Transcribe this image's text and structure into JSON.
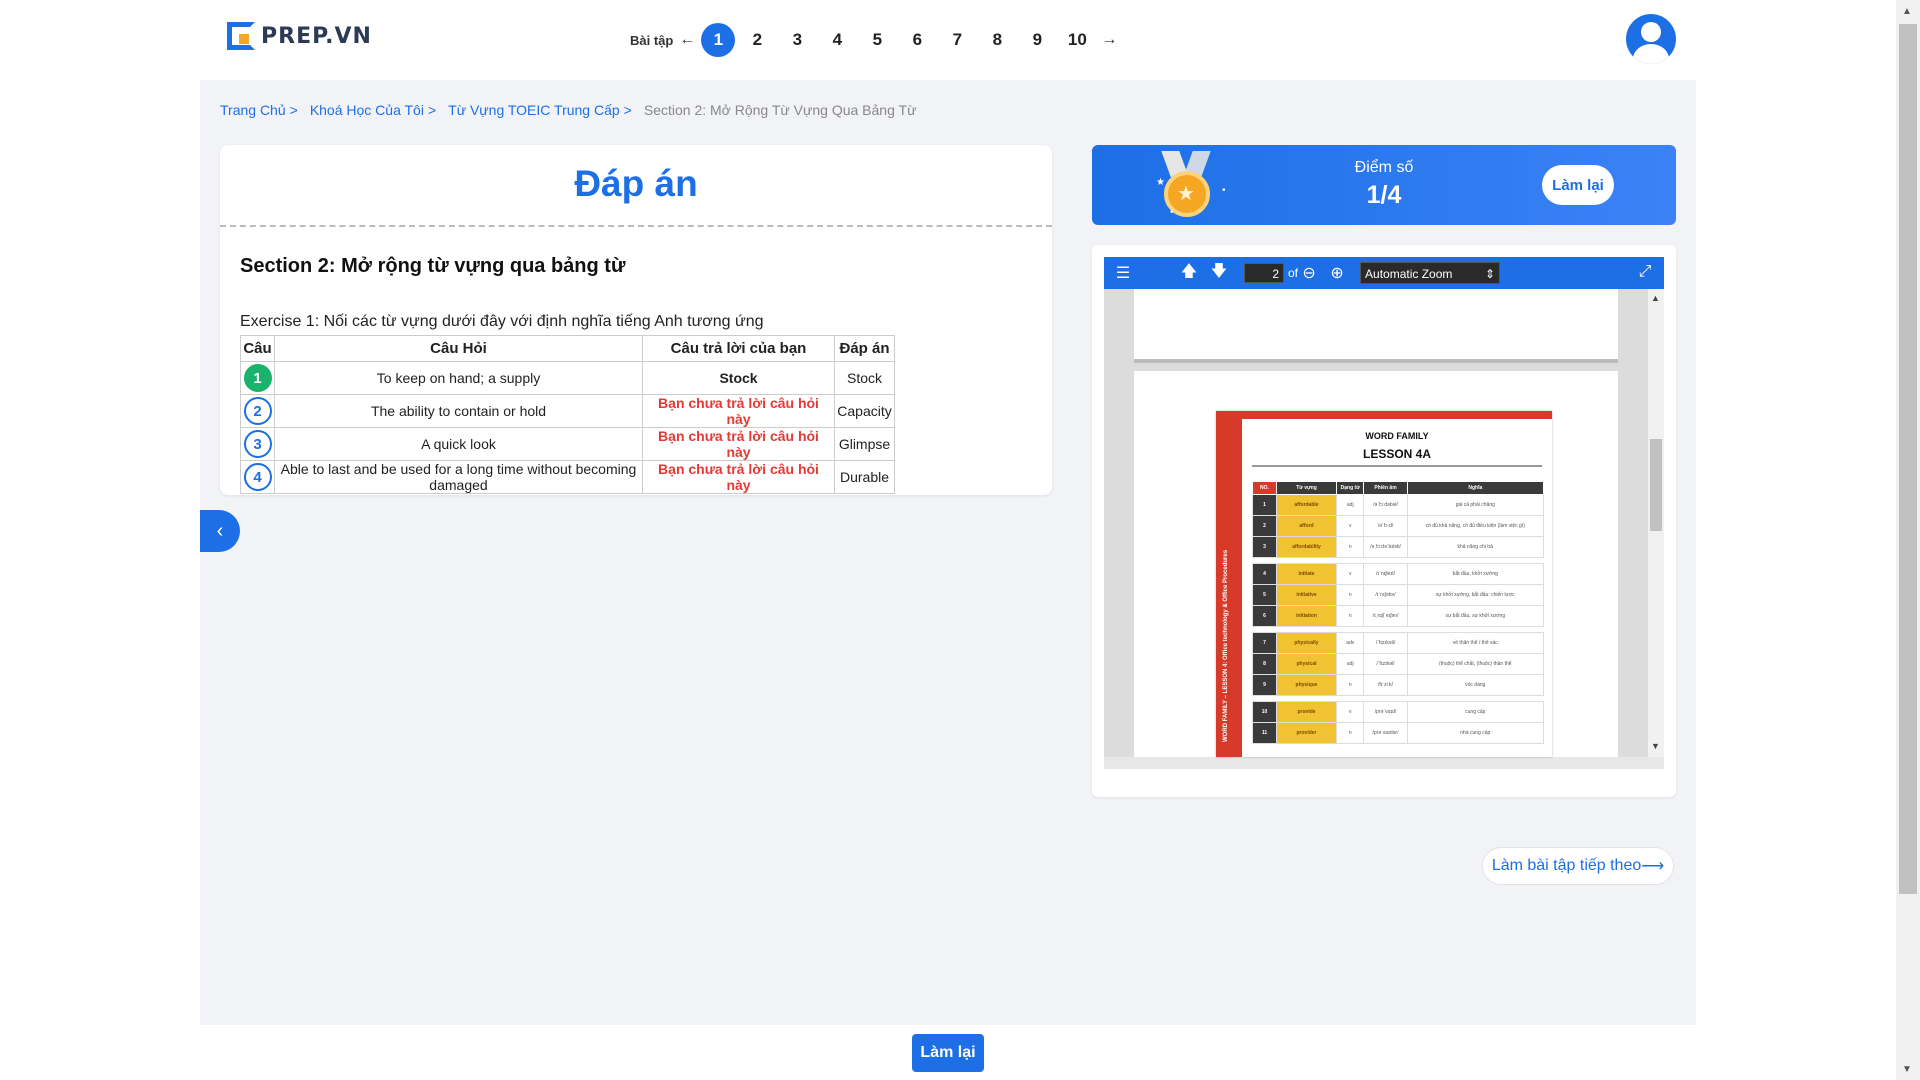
{
  "header": {
    "logo_text": "PREP.VN",
    "pager_label": "Bài tập",
    "pager_prev": "←",
    "pager_next": "→",
    "pages": [
      "1",
      "2",
      "3",
      "4",
      "5",
      "6",
      "7",
      "8",
      "9",
      "10"
    ],
    "active_page": "1"
  },
  "breadcrumb": {
    "items": [
      "Trang Chủ",
      "Khoá Học Của Tôi",
      "Từ Vựng TOEIC Trung Cấp"
    ],
    "separator": ">",
    "current": "Section 2: Mở Rộng Từ Vựng Qua Bảng Từ"
  },
  "answer": {
    "title": "Đáp án",
    "section_title": "Section 2: Mở rộng từ vựng qua bảng từ",
    "exercise_label": "Exercise 1: Nối các từ vựng dưới đây với định nghĩa tiếng Anh tương ứng",
    "columns": [
      "Câu",
      "Câu Hỏi",
      "Câu trả lời của bạn",
      "Đáp án"
    ],
    "rows": [
      {
        "num": "1",
        "question": "To keep on hand; a supply",
        "your_answer": "Stock",
        "correct_answer": "Stock",
        "status": "correct"
      },
      {
        "num": "2",
        "question": "The ability to contain or hold",
        "your_answer": "Bạn chưa trả lời câu hỏi này",
        "correct_answer": "Capacity",
        "status": "unanswered"
      },
      {
        "num": "3",
        "question": "A quick look",
        "your_answer": "Bạn chưa trả lời câu hỏi này",
        "correct_answer": "Glimpse",
        "status": "unanswered"
      },
      {
        "num": "4",
        "question": "Able to last and be used for a long time without becoming damaged",
        "your_answer": "Bạn chưa trả lời câu hỏi này",
        "correct_answer": "Durable",
        "status": "unanswered"
      }
    ]
  },
  "score": {
    "label": "Điểm số",
    "value": "1/4",
    "retry_label": "Làm lại"
  },
  "viewer": {
    "page_number": "2",
    "of_label": "of",
    "zoom_label": "Automatic Zoom",
    "doc_heading": "WORD FAMILY",
    "doc_lesson": "LESSON 4A",
    "doc_side_text": "WORD FAMILY – LESSON 4: Office technology & Office Procedures",
    "doc_columns": [
      "NO.",
      "Từ vựng",
      "Dạng từ",
      "Phiên âm",
      "Nghĩa"
    ],
    "doc_rows": [
      {
        "no": "1",
        "word": "affordable",
        "pos": "adj",
        "ipa": "/əˈfɔːdəbəl/",
        "meaning": "giá cả phải chăng"
      },
      {
        "no": "2",
        "word": "afford",
        "pos": "v",
        "ipa": "/əˈfɔːd/",
        "meaning": "có đủ khả năng, có đủ điều kiện (làm việc gì)"
      },
      {
        "no": "3",
        "word": "affordability",
        "pos": "n",
        "ipa": "/əˌfɔːdəˈbɪləti/",
        "meaning": "khả năng chi trả"
      },
      {
        "no": "4",
        "word": "initiate",
        "pos": "v",
        "ipa": "/ɪˈnɪʃieɪt/",
        "meaning": "bắt đầu, khởi xướng"
      },
      {
        "no": "5",
        "word": "initiative",
        "pos": "n",
        "ipa": "/ɪˈnɪʃətɪv/",
        "meaning": "sự khởi xướng, bắt đầu; chiến lược"
      },
      {
        "no": "6",
        "word": "initiation",
        "pos": "n",
        "ipa": "/ɪˌnɪʃiˈeɪʃən/",
        "meaning": "sự bắt đầu, sự khởi xướng"
      },
      {
        "no": "7",
        "word": "physically",
        "pos": "adv",
        "ipa": "/ˈfɪzɪkəli/",
        "meaning": "về thân thể / thể xác"
      },
      {
        "no": "8",
        "word": "physical",
        "pos": "adj",
        "ipa": "/ˈfɪzɪkəl/",
        "meaning": "(thuộc) thể chất, (thuộc) thân thể"
      },
      {
        "no": "9",
        "word": "physique",
        "pos": "n",
        "ipa": "/fɪˈziːk/",
        "meaning": "vóc dáng"
      },
      {
        "no": "10",
        "word": "provide",
        "pos": "v",
        "ipa": "/prəˈvaɪd/",
        "meaning": "cung cấp"
      },
      {
        "no": "11",
        "word": "provider",
        "pos": "n",
        "ipa": "/prəˈvaɪdər/",
        "meaning": "nhà cung cấp"
      }
    ]
  },
  "next_exercise_label": "Làm bài tập tiếp theo",
  "bottom_retry_label": "Làm lại",
  "colors": {
    "primary": "#1d6fe6",
    "correct": "#19b36b",
    "error": "#e53935",
    "word_highlight": "#f1c232",
    "doc_accent": "#d83a2a"
  }
}
